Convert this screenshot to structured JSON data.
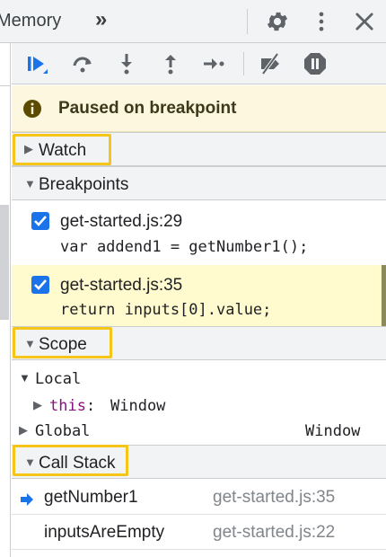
{
  "topbar": {
    "tab_label": "Memory",
    "more_tabs_glyph": "»",
    "icons": [
      "gear-icon",
      "kebab-menu-icon",
      "close-icon"
    ]
  },
  "toolbar": {
    "buttons": [
      "resume-icon",
      "step-over-icon",
      "step-into-icon",
      "step-out-icon",
      "step-icon",
      "deactivate-breakpoints-icon",
      "pause-on-exceptions-icon"
    ],
    "accent_color": "#1a73e8"
  },
  "banner": {
    "text": "Paused on breakpoint",
    "icon": "info-icon",
    "background": "#fef7e0"
  },
  "sections": {
    "watch": "Watch",
    "breakpoints": "Breakpoints",
    "scope": "Scope",
    "call_stack": "Call Stack"
  },
  "breakpoints": [
    {
      "file": "get-started.js:29",
      "code": "var addend1 = getNumber1();",
      "checked": true,
      "active": false
    },
    {
      "file": "get-started.js:35",
      "code": "return inputs[0].value;",
      "checked": true,
      "active": true
    }
  ],
  "scope": {
    "local_label": "Local",
    "this_key": "this",
    "this_sep": ":",
    "this_value": "Window",
    "global_label": "Global",
    "global_value": "Window"
  },
  "call_stack": [
    {
      "fn": "getNumber1",
      "loc": "get-started.js:35",
      "current": true
    },
    {
      "fn": "inputsAreEmpty",
      "loc": "get-started.js:22",
      "current": false
    }
  ],
  "highlight_color": "#f5c518"
}
